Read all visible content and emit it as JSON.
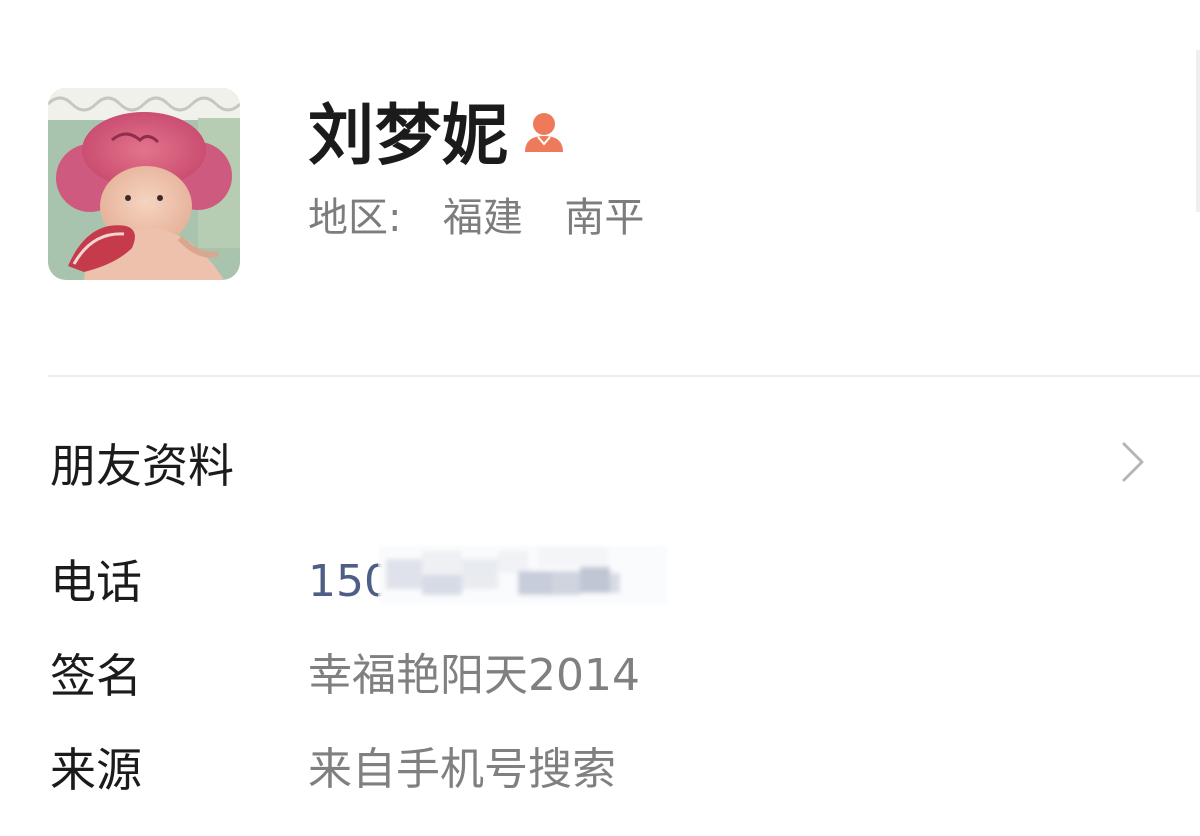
{
  "profile": {
    "name": "刘梦妮",
    "gender_icon": "female-user-icon",
    "region_label": "地区:",
    "region_province": "福建",
    "region_city": "南平"
  },
  "menu": {
    "profile_label": "朋友资料",
    "chevron_icon": "chevron-right-icon"
  },
  "info": {
    "phone_label": "电话",
    "phone_value": "150",
    "signature_label": "签名",
    "signature_value": "幸福艳阳天2014",
    "source_label": "来源",
    "source_value": "来自手机号搜索"
  },
  "colors": {
    "accent_gender": "#ef7a5a",
    "phone_text": "#4e5e86"
  }
}
